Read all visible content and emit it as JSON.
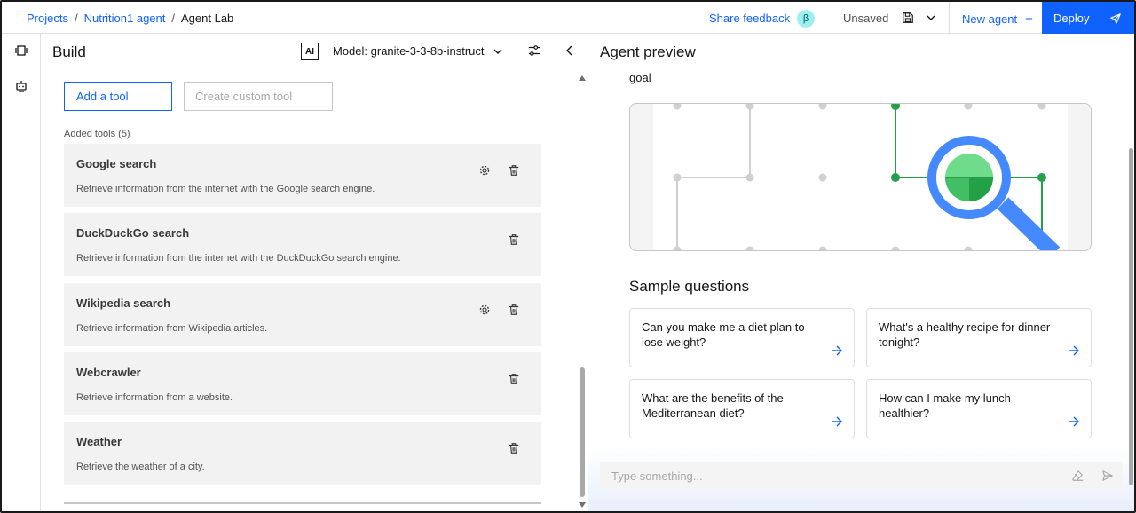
{
  "breadcrumb": {
    "items": [
      {
        "label": "Projects"
      },
      {
        "label": "Nutrition1 agent"
      }
    ],
    "current": "Agent Lab",
    "separator": "/"
  },
  "header": {
    "share_feedback": "Share feedback",
    "beta_badge": "β",
    "save_status": "Unsaved",
    "new_agent": "New agent",
    "new_agent_icon": "+",
    "deploy": "Deploy"
  },
  "build": {
    "title": "Build",
    "ai_badge": "AI",
    "model_label": "Model: granite-3-3-8b-instruct",
    "add_tool": "Add a tool",
    "create_custom_tool": "Create custom tool",
    "added_tools_label": "Added tools (5)",
    "tools": [
      {
        "name": "Google search",
        "description": "Retrieve information from the internet with the Google search engine.",
        "has_settings": true
      },
      {
        "name": "DuckDuckGo search",
        "description": "Retrieve information from the internet with the DuckDuckGo search engine.",
        "has_settings": false
      },
      {
        "name": "Wikipedia search",
        "description": "Retrieve information from Wikipedia articles.",
        "has_settings": true
      },
      {
        "name": "Webcrawler",
        "description": "Retrieve information from a website.",
        "has_settings": false
      },
      {
        "name": "Weather",
        "description": "Retrieve the weather of a city.",
        "has_settings": false
      }
    ]
  },
  "preview": {
    "title": "Agent preview",
    "goal_text": "goal",
    "sample_questions_title": "Sample questions",
    "questions": [
      {
        "text": "Can you make me a diet plan to lose weight?"
      },
      {
        "text": "What's a healthy recipe for dinner tonight?"
      },
      {
        "text": "What are the benefits of the Mediterranean diet?"
      },
      {
        "text": "How can I make my lunch healthier?"
      }
    ],
    "input_placeholder": "Type something..."
  },
  "colors": {
    "accent": "#0f62fe",
    "illustration_green": "#24a148",
    "illustration_blue": "#4589ff"
  }
}
